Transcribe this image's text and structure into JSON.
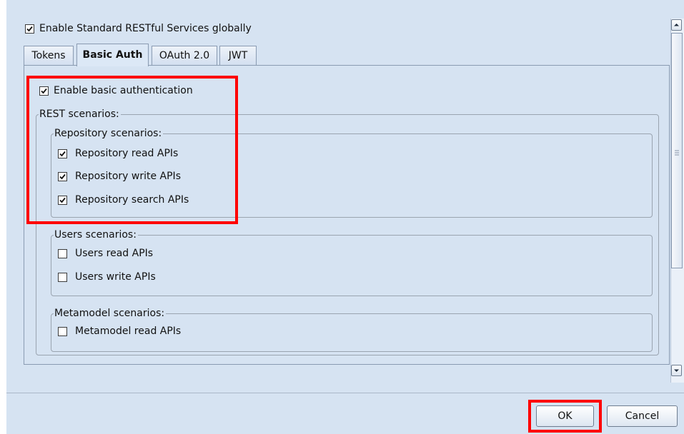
{
  "global": {
    "enable_label": "Enable Standard RESTful Services globally",
    "checked": true
  },
  "tabs": [
    {
      "label": "Tokens",
      "active": false
    },
    {
      "label": "Basic Auth",
      "active": true
    },
    {
      "label": "OAuth 2.0",
      "active": false
    },
    {
      "label": "JWT",
      "active": false
    }
  ],
  "basic_auth": {
    "enable_label": "Enable basic authentication",
    "enable_checked": true,
    "rest_scenarios_title": "REST scenarios:",
    "repository": {
      "title": "Repository scenarios:",
      "items": [
        {
          "label": "Repository read APIs",
          "checked": true
        },
        {
          "label": "Repository write APIs",
          "checked": true
        },
        {
          "label": "Repository search APIs",
          "checked": true
        }
      ]
    },
    "users": {
      "title": "Users scenarios:",
      "items": [
        {
          "label": "Users read APIs",
          "checked": false
        },
        {
          "label": "Users write APIs",
          "checked": false
        }
      ]
    },
    "metamodel": {
      "title": "Metamodel scenarios:",
      "items": [
        {
          "label": "Metamodel read APIs",
          "checked": false
        }
      ]
    }
  },
  "buttons": {
    "ok": "OK",
    "cancel": "Cancel"
  },
  "colors": {
    "highlight": "#ff0000",
    "background": "#d6e3f2"
  }
}
